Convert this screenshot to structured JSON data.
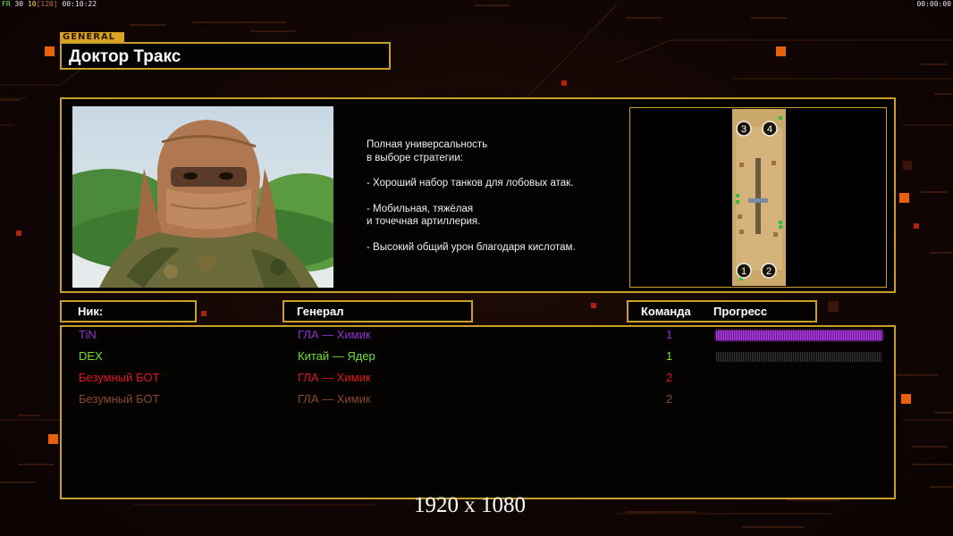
{
  "hud": {
    "fps_label": "FR",
    "fps": "30",
    "rate": "10",
    "rate_cap": "[120]",
    "time_left": "00:10:22",
    "time_right": "00:00:00"
  },
  "general": {
    "tag": "GENERAL",
    "name": "Доктор Тракс",
    "description": [
      "Полная универсальность\nв выборе стратегии:",
      "- Хороший набор танков для лобовых атак.",
      "- Мобильная, тяжёлая\nи точечная артиллерия.",
      "- Высокий общий урон благодаря кислотам."
    ]
  },
  "map": {
    "slots": [
      "3",
      "4",
      "1",
      "2"
    ]
  },
  "columns": {
    "nick": "Ник:",
    "general": "Генерал",
    "team": "Команда",
    "progress": "Прогресс"
  },
  "players": [
    {
      "nick": "TiN",
      "general": "ГЛА — Химик",
      "team": "1",
      "color": "#9030d0",
      "progress": 1.0
    },
    {
      "nick": "DEX",
      "general": "Китай — Ядер",
      "team": "1",
      "color": "#70e030",
      "progress": 0.0
    },
    {
      "nick": "Безумный БОТ",
      "general": "ГЛА — Химик",
      "team": "2",
      "color": "#e01818",
      "progress": null
    },
    {
      "nick": "Безумный БОТ",
      "general": "ГЛА — Химик",
      "team": "2",
      "color": "#8a4a2a",
      "progress": null
    }
  ],
  "overlay": {
    "resolution": "1920 x 1080"
  },
  "colors": {
    "accent": "#c8a028",
    "progress_fill": "#b040e0",
    "progress_empty": "#3a3a3a"
  }
}
